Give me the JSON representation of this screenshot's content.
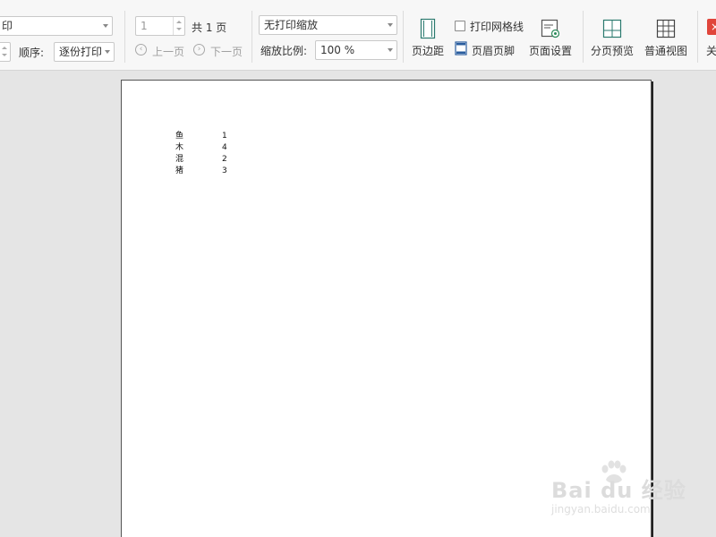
{
  "toolbar": {
    "print_mode_combo": "印",
    "order_label": "顺序:",
    "order_combo": "逐份打印",
    "page_input": "1",
    "total_pages": "共 1 页",
    "prev_page": "上一页",
    "next_page": "下一页",
    "scale_mode_combo": "无打印缩放",
    "zoom_label": "缩放比例:",
    "zoom_combo": "100 %",
    "margins_button": "页边距",
    "gridlines_checkbox": "打印网格线",
    "header_footer_button": "页眉页脚",
    "page_setup_button": "页面设置",
    "page_break_preview_button": "分页预览",
    "normal_view_button": "普通视图",
    "close_button": "关",
    "close_glyph": "×"
  },
  "sheet": {
    "rows": [
      {
        "name": "鱼",
        "value": "1"
      },
      {
        "name": "木",
        "value": "4"
      },
      {
        "name": "混",
        "value": "2"
      },
      {
        "name": "猪",
        "value": "3"
      }
    ]
  },
  "watermark": {
    "brand": "Bai du 经验",
    "url": "jingyan.baidu.com"
  }
}
